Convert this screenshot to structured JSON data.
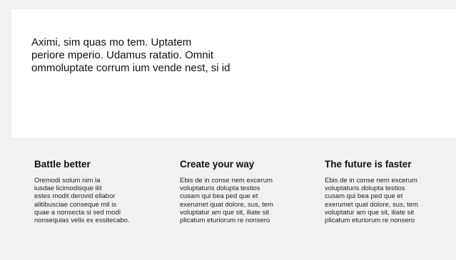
{
  "hero": {
    "text": "Aximi, sim quas mo tem. Uptatem\nperiore mperio. Udamus ratatio. Omnit\nommoluptate corrum ium vende nest, si id"
  },
  "features": [
    {
      "title": "Battle better",
      "body": "Oremodi solum nim la\niusdae licimodisque ilit\nestes modit derovid ellabor\nalitibusciae conseque mil is\nquae a nonsecta si sed modi\nnonsequias velis ex essitecabo."
    },
    {
      "title": "Create your way",
      "body": "Ebis de in conse nem excerum\nvoluptaturis dolupta testios\ncusam qui bea ped que et\nexerumet quat dolore, sus, tem\nvoluptatur am que sit, iliate sit\nplicatum eturiorum re nonsero"
    },
    {
      "title": "The future is faster",
      "body": "Ebis de in conse nem excerum\nvoluptaturis dolupta testios\ncusam qui bea ped que et\nexerumet quat dolore, sus, tem\nvoluptatur am que sit, iliate sit\nplicatum eturiorum re nonsero"
    }
  ]
}
